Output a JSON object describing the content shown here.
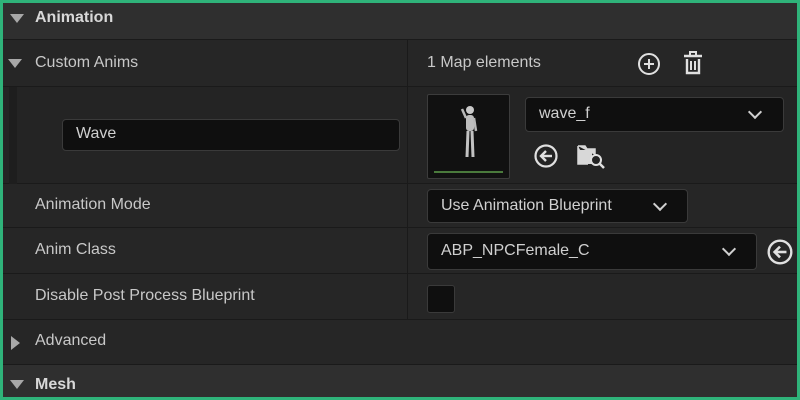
{
  "sections": {
    "animation_title": "Animation",
    "mesh_title": "Mesh"
  },
  "custom_anims": {
    "label": "Custom Anims",
    "count_text": "1 Map elements",
    "key_value": "Wave",
    "asset_name": "wave_f"
  },
  "animation_mode": {
    "label": "Animation Mode",
    "value": "Use Animation Blueprint"
  },
  "anim_class": {
    "label": "Anim Class",
    "value": "ABP_NPCFemale_C"
  },
  "disable_post_process": {
    "label": "Disable Post Process Blueprint",
    "checked": false
  },
  "advanced": {
    "label": "Advanced"
  },
  "colors": {
    "frame_border": "#2fb37a",
    "panel_bg": "#242424",
    "field_bg": "#0f0f0f",
    "text": "#c8c8c8"
  }
}
